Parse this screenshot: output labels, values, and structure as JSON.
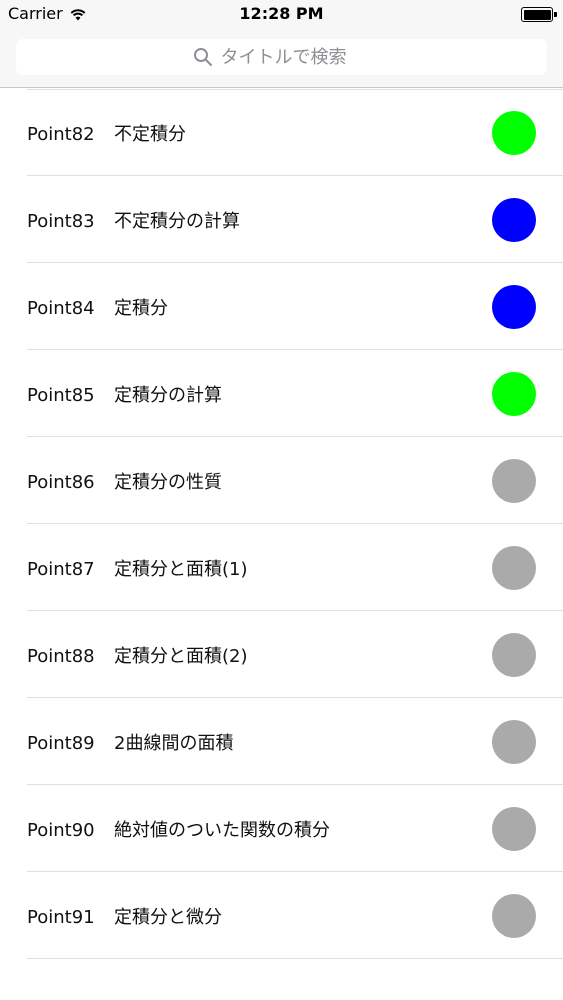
{
  "status_bar": {
    "carrier": "Carrier",
    "time": "12:28 PM"
  },
  "search": {
    "placeholder": "タイトルで検索",
    "icon": "search-icon"
  },
  "colors": {
    "complete": "#00ff00",
    "in_progress": "#0000ff",
    "not_started": "#aaaaaa"
  },
  "items": [
    {
      "number": "Point82",
      "title": "不定積分",
      "status": "complete",
      "color": "#00ff00"
    },
    {
      "number": "Point83",
      "title": "不定積分の計算",
      "status": "in_progress",
      "color": "#0000ff"
    },
    {
      "number": "Point84",
      "title": "定積分",
      "status": "in_progress",
      "color": "#0000ff"
    },
    {
      "number": "Point85",
      "title": "定積分の計算",
      "status": "complete",
      "color": "#00ff00"
    },
    {
      "number": "Point86",
      "title": "定積分の性質",
      "status": "not_started",
      "color": "#aaaaaa"
    },
    {
      "number": "Point87",
      "title": "定積分と面積(1)",
      "status": "not_started",
      "color": "#aaaaaa"
    },
    {
      "number": "Point88",
      "title": "定積分と面積(2)",
      "status": "not_started",
      "color": "#aaaaaa"
    },
    {
      "number": "Point89",
      "title": "2曲線間の面積",
      "status": "not_started",
      "color": "#aaaaaa"
    },
    {
      "number": "Point90",
      "title": "絶対値のついた関数の積分",
      "status": "not_started",
      "color": "#aaaaaa"
    },
    {
      "number": "Point91",
      "title": "定積分と微分",
      "status": "not_started",
      "color": "#aaaaaa"
    }
  ]
}
